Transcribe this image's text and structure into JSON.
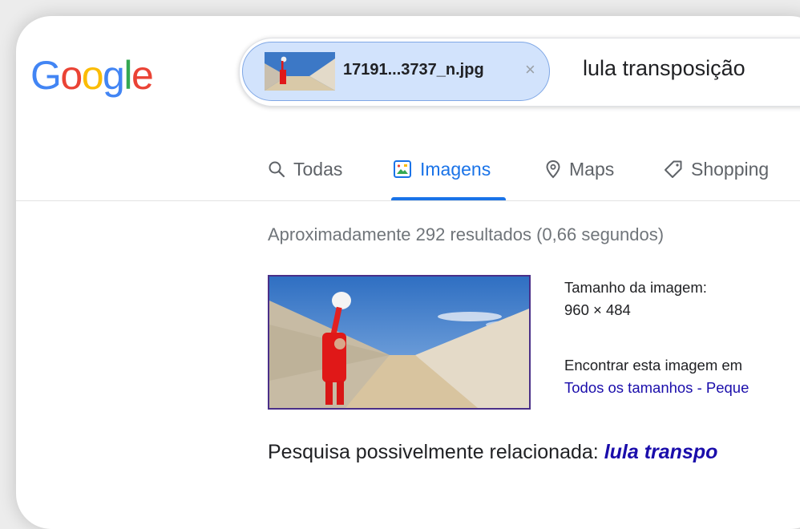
{
  "logo": {
    "letters": [
      "G",
      "o",
      "o",
      "g",
      "l",
      "e"
    ],
    "colors": [
      "#4285F4",
      "#EA4335",
      "#FBBC05",
      "#4285F4",
      "#34A853",
      "#EA4335"
    ]
  },
  "search": {
    "chip_filename": "17191...3737_n.jpg",
    "chip_close": "×",
    "query": "lula transposição"
  },
  "tabs": [
    {
      "label": "Todas",
      "icon": "search-icon",
      "active": false
    },
    {
      "label": "Imagens",
      "icon": "image-icon",
      "active": true
    },
    {
      "label": "Maps",
      "icon": "location-pin-icon",
      "active": false
    },
    {
      "label": "Shopping",
      "icon": "tag-icon",
      "active": false
    }
  ],
  "results": {
    "stats": "Aproximadamente 292 resultados (0,66 segundos)",
    "image_size_label": "Tamanho da imagem:",
    "image_size_value": "960 × 484",
    "find_label": "Encontrar esta imagem em",
    "size_links": "Todos os tamanhos - Peque",
    "related_label": "Pesquisa possivelmente relacionada: ",
    "related_link": "lula transpo"
  },
  "colors": {
    "accent": "#1a73e8",
    "link": "#1a0dab",
    "chip_bg": "#d2e3fc"
  }
}
